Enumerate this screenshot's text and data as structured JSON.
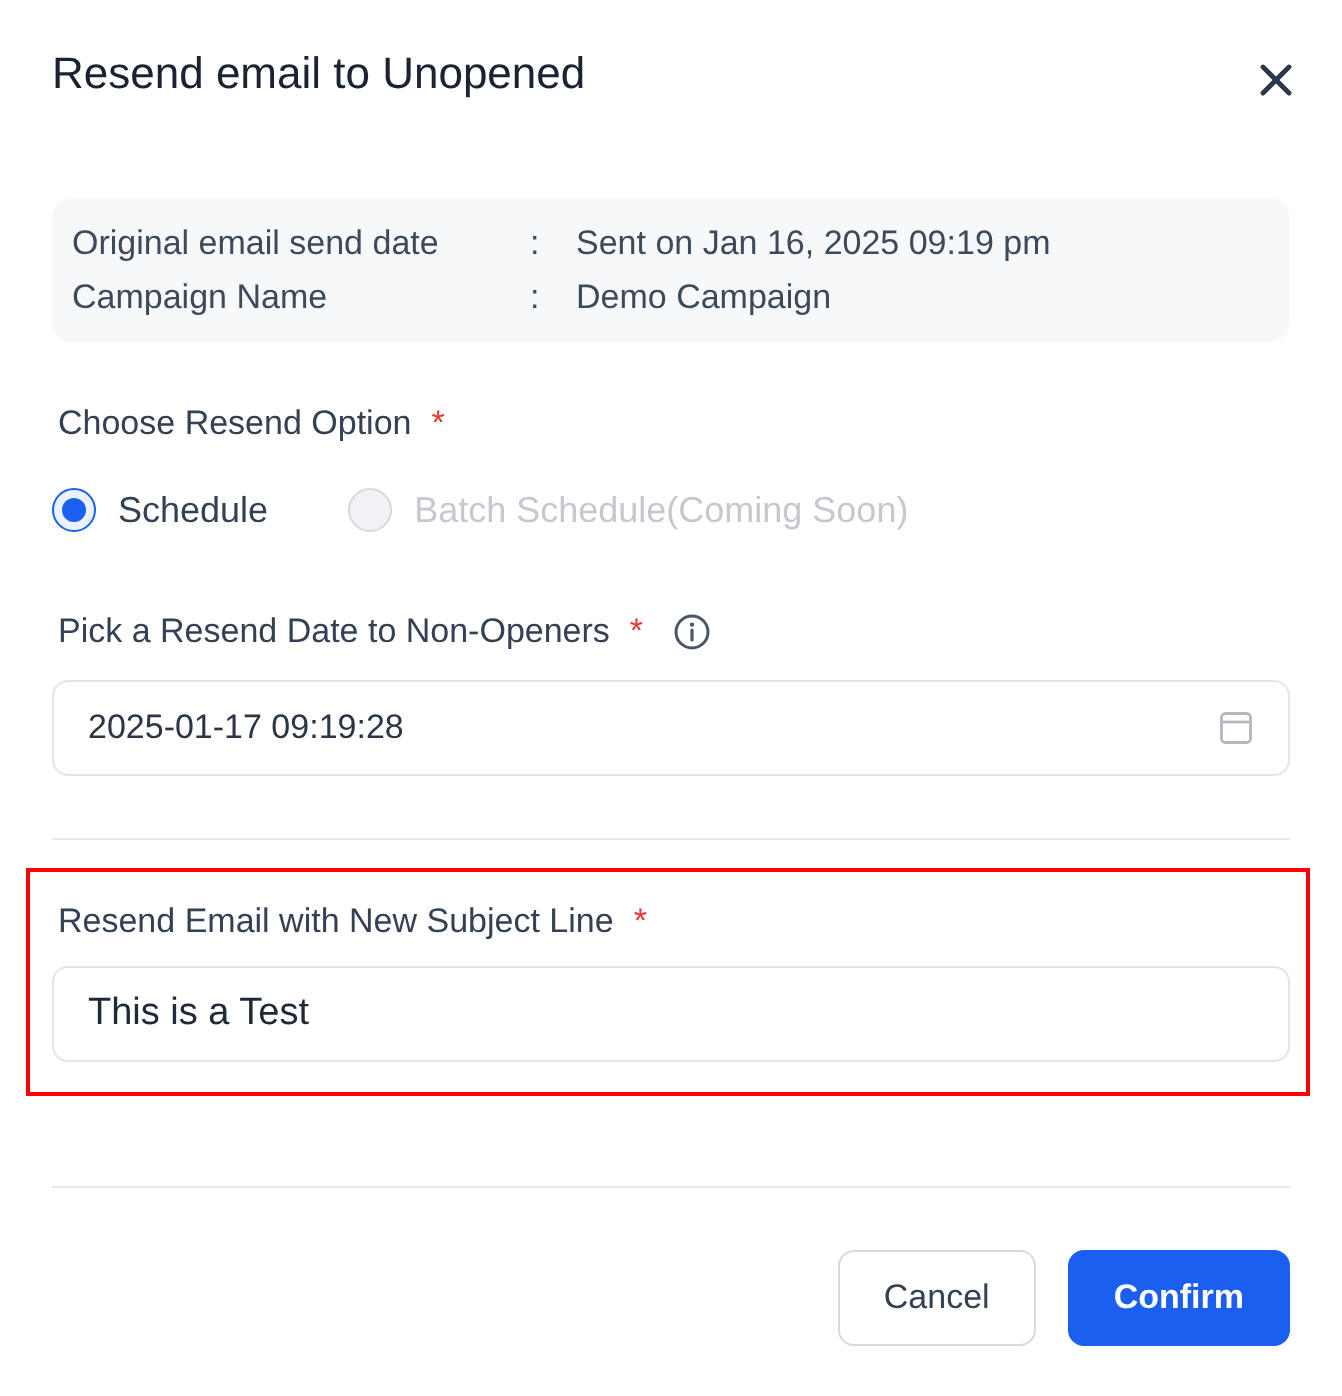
{
  "dialog": {
    "title": "Resend email to Unopened"
  },
  "info": [
    {
      "label": "Original email send date",
      "separator": ":",
      "value": "Sent on Jan 16, 2025 09:19 pm"
    },
    {
      "label": "Campaign Name",
      "separator": ":",
      "value": "Demo Campaign"
    }
  ],
  "resend_option": {
    "label": "Choose Resend Option",
    "required_mark": "*",
    "options": [
      {
        "label": "Schedule",
        "selected": true,
        "disabled": false
      },
      {
        "label": "Batch Schedule(Coming Soon)",
        "selected": false,
        "disabled": true
      }
    ]
  },
  "resend_date": {
    "label": "Pick a Resend Date to Non-Openers",
    "required_mark": "*",
    "value": "2025-01-17 09:19:28"
  },
  "subject_line": {
    "label": "Resend Email with New Subject Line",
    "required_mark": "*",
    "value": "This is a Test",
    "highlighted": true
  },
  "buttons": [
    {
      "label": "Cancel",
      "kind": "secondary"
    },
    {
      "label": "Confirm",
      "kind": "primary"
    }
  ]
}
